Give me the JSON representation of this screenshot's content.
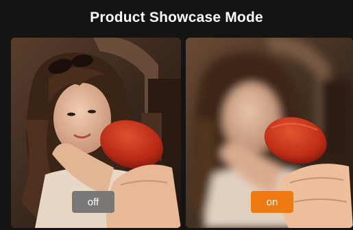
{
  "header": {
    "title": "Product Showcase Mode"
  },
  "comparison": {
    "left": {
      "mode": "off",
      "toggle_label": "off",
      "toggle_color": "#707070"
    },
    "right": {
      "mode": "on",
      "toggle_label": "on",
      "toggle_color": "#f07a12"
    }
  },
  "colors": {
    "background": "#141414",
    "accent": "#f07a12",
    "title_text": "#ffffff"
  }
}
